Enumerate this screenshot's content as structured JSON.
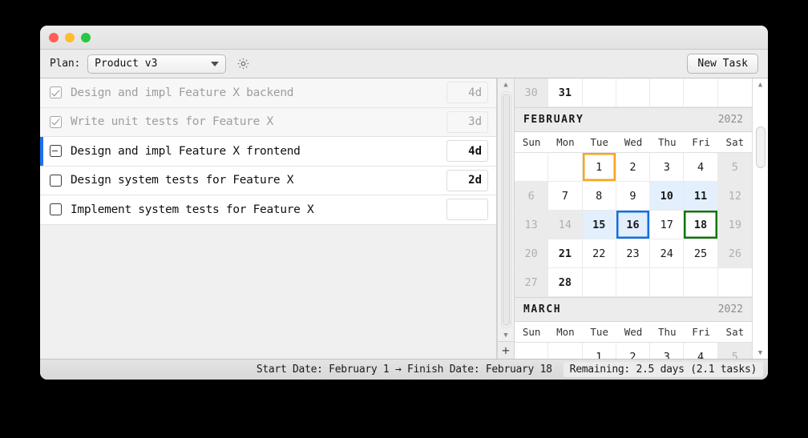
{
  "window": {
    "traffic_lights": [
      "close",
      "minimize",
      "zoom"
    ]
  },
  "toolbar": {
    "plan_label": "Plan:",
    "plan_value": "Product v3",
    "gear_icon": "gear-icon",
    "new_task_label": "New Task"
  },
  "tasks": {
    "rows": [
      {
        "title": "Design and impl Feature X backend",
        "duration": "4d",
        "state": "checked",
        "selected": false,
        "muted": true
      },
      {
        "title": "Write unit tests for Feature X",
        "duration": "3d",
        "state": "checked",
        "selected": false,
        "muted": true
      },
      {
        "title": "Design and impl Feature X frontend",
        "duration": "4d",
        "state": "partial",
        "selected": true,
        "muted": false
      },
      {
        "title": "Design system tests for Feature X",
        "duration": "2d",
        "state": "unchecked",
        "selected": false,
        "muted": false
      },
      {
        "title": "Implement system tests for Feature X",
        "duration": "",
        "state": "unchecked",
        "selected": false,
        "muted": false
      }
    ],
    "add_button_label": "+"
  },
  "calendar": {
    "weekday_headers": [
      "Sun",
      "Mon",
      "Tue",
      "Wed",
      "Thu",
      "Fri",
      "Sat"
    ],
    "partial_top_week": [
      {
        "d": "30",
        "cls": "off"
      },
      {
        "d": "31",
        "cls": "bold"
      },
      {
        "d": "",
        "cls": "blank"
      },
      {
        "d": "",
        "cls": "blank"
      },
      {
        "d": "",
        "cls": "blank"
      },
      {
        "d": "",
        "cls": "blank"
      },
      {
        "d": "",
        "cls": "blank"
      }
    ],
    "months": [
      {
        "name": "FEBRUARY",
        "year": "2022",
        "weeks": [
          [
            {
              "d": "",
              "cls": "blank"
            },
            {
              "d": "",
              "cls": "blank"
            },
            {
              "d": "1",
              "cls": "bd-orange"
            },
            {
              "d": "2",
              "cls": ""
            },
            {
              "d": "3",
              "cls": ""
            },
            {
              "d": "4",
              "cls": ""
            },
            {
              "d": "5",
              "cls": "off"
            }
          ],
          [
            {
              "d": "6",
              "cls": "off"
            },
            {
              "d": "7",
              "cls": ""
            },
            {
              "d": "8",
              "cls": ""
            },
            {
              "d": "9",
              "cls": ""
            },
            {
              "d": "10",
              "cls": "range"
            },
            {
              "d": "11",
              "cls": "range"
            },
            {
              "d": "12",
              "cls": "off"
            }
          ],
          [
            {
              "d": "13",
              "cls": "off"
            },
            {
              "d": "14",
              "cls": "off"
            },
            {
              "d": "15",
              "cls": "range"
            },
            {
              "d": "16",
              "cls": "range bd-blue"
            },
            {
              "d": "17",
              "cls": ""
            },
            {
              "d": "18",
              "cls": "bold bd-green"
            },
            {
              "d": "19",
              "cls": "off"
            }
          ],
          [
            {
              "d": "20",
              "cls": "off"
            },
            {
              "d": "21",
              "cls": "bold"
            },
            {
              "d": "22",
              "cls": ""
            },
            {
              "d": "23",
              "cls": ""
            },
            {
              "d": "24",
              "cls": ""
            },
            {
              "d": "25",
              "cls": ""
            },
            {
              "d": "26",
              "cls": "off"
            }
          ],
          [
            {
              "d": "27",
              "cls": "off"
            },
            {
              "d": "28",
              "cls": "bold"
            },
            {
              "d": "",
              "cls": "blank"
            },
            {
              "d": "",
              "cls": "blank"
            },
            {
              "d": "",
              "cls": "blank"
            },
            {
              "d": "",
              "cls": "blank"
            },
            {
              "d": "",
              "cls": "blank"
            }
          ]
        ]
      },
      {
        "name": "MARCH",
        "year": "2022",
        "weeks": [
          [
            {
              "d": "",
              "cls": "blank"
            },
            {
              "d": "",
              "cls": "blank"
            },
            {
              "d": "1",
              "cls": ""
            },
            {
              "d": "2",
              "cls": ""
            },
            {
              "d": "3",
              "cls": ""
            },
            {
              "d": "4",
              "cls": ""
            },
            {
              "d": "5",
              "cls": "off"
            }
          ]
        ]
      }
    ]
  },
  "statusbar": {
    "dates": "Start Date: February 1 → Finish Date: February 18",
    "remaining": "Remaining: 2.5 days (2.1 tasks)"
  },
  "colors": {
    "selection_blue": "#1c72f0",
    "range_fill": "#e3effc",
    "start_border": "#f5a623",
    "today_border": "#1070e0",
    "finish_border": "#137512"
  }
}
